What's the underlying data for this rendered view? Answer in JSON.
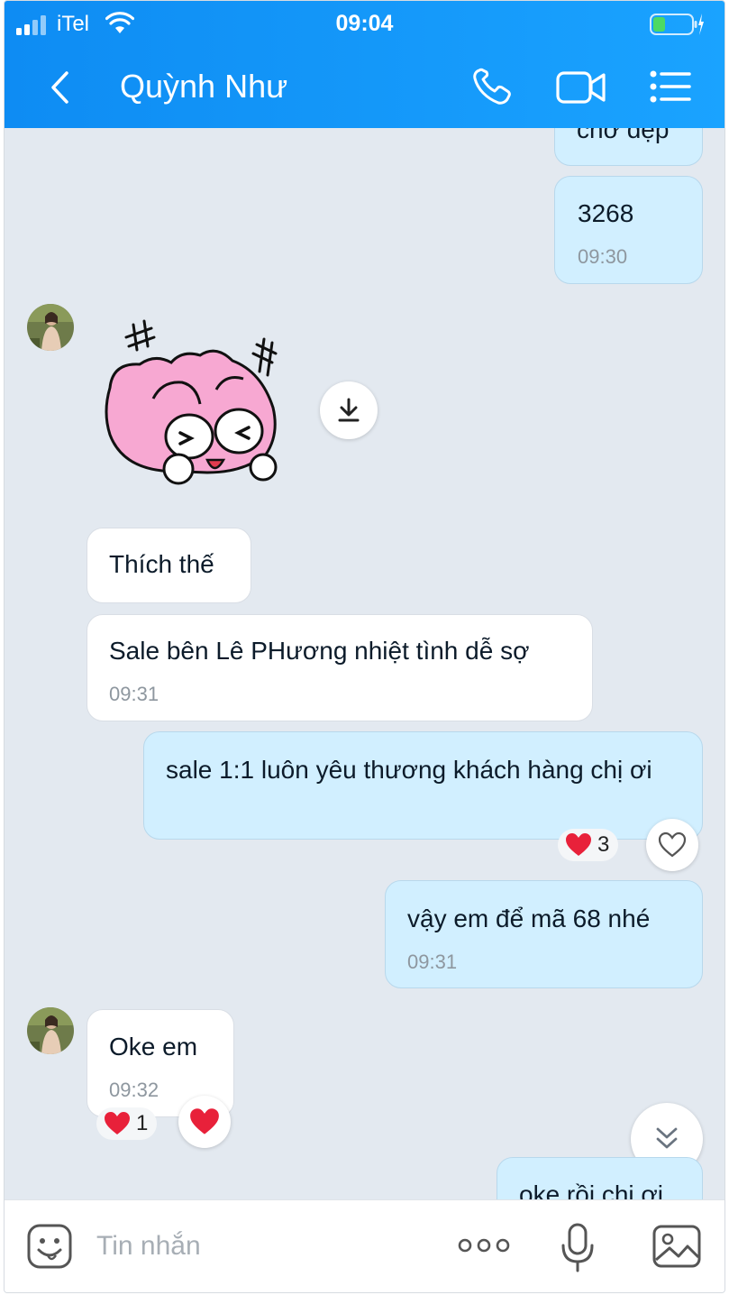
{
  "status_bar": {
    "carrier": "iTel",
    "time": "09:04"
  },
  "header": {
    "title": "Quỳnh Như",
    "back_icon": "chevron-left-icon",
    "call_icon": "phone-icon",
    "video_icon": "video-camera-icon",
    "menu_icon": "list-menu-icon"
  },
  "messages": [
    {
      "side": "out",
      "text": "chờ đẹp"
    },
    {
      "side": "out",
      "text": "3268",
      "time": "09:30"
    },
    {
      "side": "in",
      "type": "sticker"
    },
    {
      "side": "in",
      "text": "Thích thế"
    },
    {
      "side": "in",
      "text": "Sale bên Lê PHương nhiệt tình dễ sợ",
      "time": "09:31"
    },
    {
      "side": "out",
      "text": "sale 1:1 luôn yêu thương khách hàng chị ơi",
      "reaction_count": "3"
    },
    {
      "side": "out",
      "text": "vậy em để mã 68 nhé",
      "time": "09:31"
    },
    {
      "side": "in",
      "text": "Oke em",
      "time": "09:32",
      "reaction_count": "1"
    },
    {
      "side": "out",
      "text": "oke rồi chị ơi"
    }
  ],
  "composer": {
    "placeholder": "Tin nhắn",
    "emoji_icon": "emoji-face-icon",
    "more_icon": "more-dots-icon",
    "mic_icon": "microphone-icon",
    "image_icon": "image-icon"
  },
  "colors": {
    "header": "#1596f7",
    "chat_bg": "#e3e9f0",
    "bubble_out": "#d1efff",
    "bubble_in": "#ffffff",
    "heart": "#e8213a"
  }
}
